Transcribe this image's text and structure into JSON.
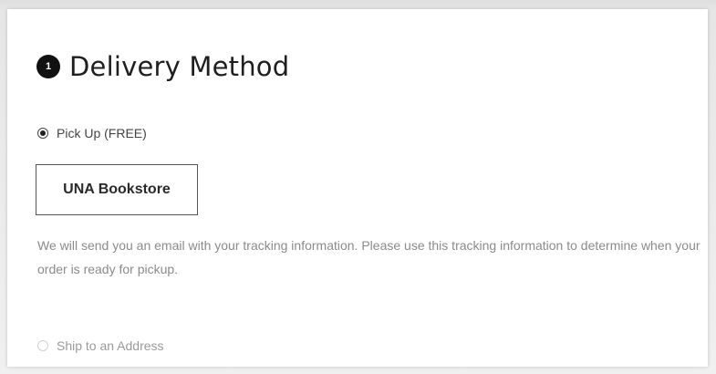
{
  "delivery": {
    "step_number": "1",
    "title": "Delivery Method",
    "options": {
      "pickup": {
        "label": "Pick Up (FREE)",
        "selected": true
      },
      "ship": {
        "label": "Ship to an Address",
        "selected": false
      }
    },
    "store_name": "UNA Bookstore",
    "info": "We will send you an email with your tracking information. Please use this tracking information to determine when your order is ready for pickup."
  }
}
